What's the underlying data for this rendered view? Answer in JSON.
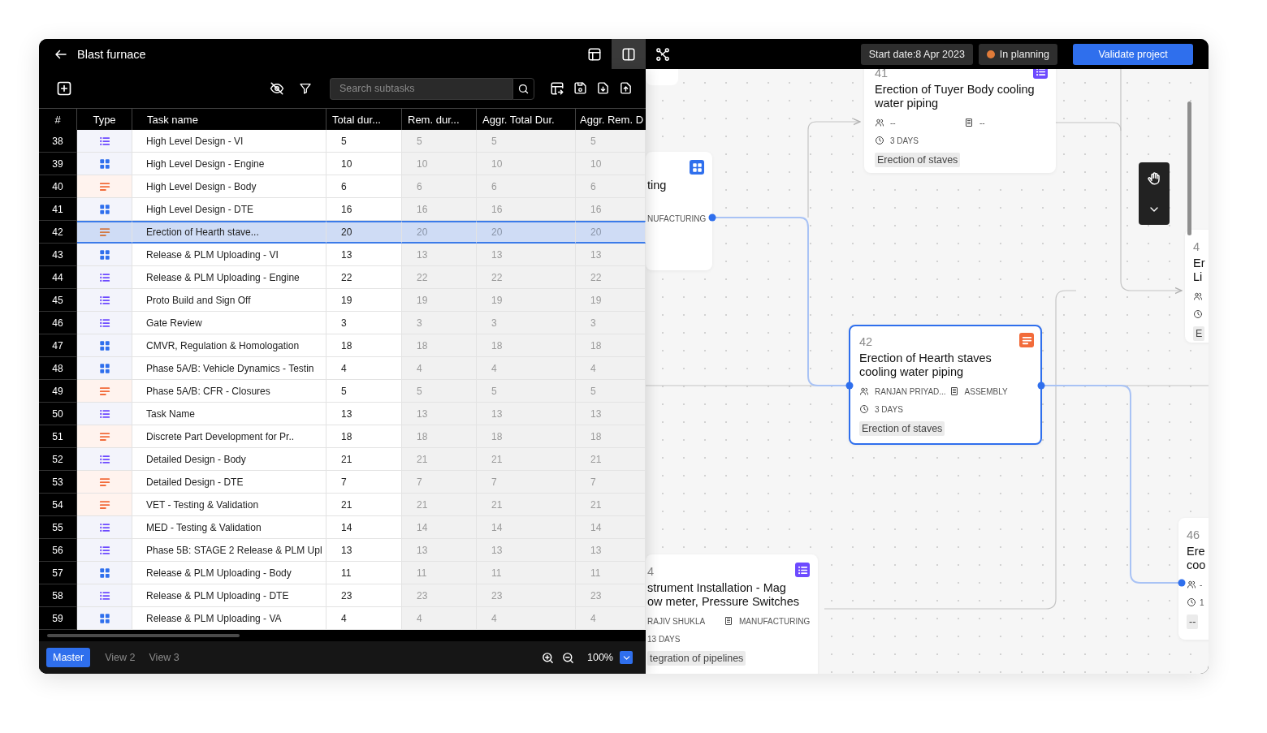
{
  "window": {
    "title": "Blast furnace"
  },
  "view_modes": [
    {
      "kind": "table",
      "selected": false
    },
    {
      "kind": "split",
      "selected": true
    },
    {
      "kind": "graph",
      "selected": false
    }
  ],
  "start_date": "Start date:8 Apr 2023",
  "status": {
    "label": "In planning",
    "color": "#e07b39"
  },
  "validate_button": "Validate project",
  "toolbar": {
    "search": {
      "placeholder": "Search subtasks"
    }
  },
  "table": {
    "columns": [
      "#",
      "Type",
      "Task name",
      "Total dur...",
      "Rem. dur...",
      "Aggr. Total Dur.",
      "Aggr. Rem. D"
    ],
    "rows": [
      {
        "number": "38",
        "kind": "list",
        "name": "High Level Design - VI",
        "total": "5",
        "rem": "5",
        "aggr_total": "5",
        "aggr_rem": "5",
        "selected": false
      },
      {
        "number": "39",
        "kind": "grid",
        "name": "High Level Design - Engine",
        "total": "10",
        "rem": "10",
        "aggr_total": "10",
        "aggr_rem": "10",
        "selected": false
      },
      {
        "number": "40",
        "kind": "lines",
        "name": "High Level Design - Body",
        "total": "6",
        "rem": "6",
        "aggr_total": "6",
        "aggr_rem": "6",
        "selected": false
      },
      {
        "number": "41",
        "kind": "grid",
        "name": "High Level Design - DTE",
        "total": "16",
        "rem": "16",
        "aggr_total": "16",
        "aggr_rem": "16",
        "selected": false
      },
      {
        "number": "42",
        "kind": "lines",
        "name": "Erection of Hearth stave...",
        "total": "20",
        "rem": "20",
        "aggr_total": "20",
        "aggr_rem": "20",
        "selected": true
      },
      {
        "number": "43",
        "kind": "grid",
        "name": "Release & PLM Uploading - VI",
        "total": "13",
        "rem": "13",
        "aggr_total": "13",
        "aggr_rem": "13",
        "selected": false
      },
      {
        "number": "44",
        "kind": "list",
        "name": "Release & PLM Uploading - Engine",
        "total": "22",
        "rem": "22",
        "aggr_total": "22",
        "aggr_rem": "22",
        "selected": false
      },
      {
        "number": "45",
        "kind": "list",
        "name": "Proto Build and Sign Off",
        "total": "19",
        "rem": "19",
        "aggr_total": "19",
        "aggr_rem": "19",
        "selected": false
      },
      {
        "number": "46",
        "kind": "list",
        "name": "Gate Review",
        "total": "3",
        "rem": "3",
        "aggr_total": "3",
        "aggr_rem": "3",
        "selected": false
      },
      {
        "number": "47",
        "kind": "grid",
        "name": "CMVR, Regulation & Homologation",
        "total": "18",
        "rem": "18",
        "aggr_total": "18",
        "aggr_rem": "18",
        "selected": false
      },
      {
        "number": "48",
        "kind": "grid",
        "name": "Phase 5A/B: Vehicle Dynamics - Testin",
        "total": "4",
        "rem": "4",
        "aggr_total": "4",
        "aggr_rem": "4",
        "selected": false
      },
      {
        "number": "49",
        "kind": "lines",
        "name": "Phase 5A/B: CFR - Closures",
        "total": "5",
        "rem": "5",
        "aggr_total": "5",
        "aggr_rem": "5",
        "selected": false
      },
      {
        "number": "50",
        "kind": "list",
        "name": "Task Name",
        "total": "13",
        "rem": "13",
        "aggr_total": "13",
        "aggr_rem": "13",
        "selected": false
      },
      {
        "number": "51",
        "kind": "lines",
        "name": "Discrete Part Development for Pr..",
        "total": "18",
        "rem": "18",
        "aggr_total": "18",
        "aggr_rem": "18",
        "selected": false
      },
      {
        "number": "52",
        "kind": "list",
        "name": "Detailed Design - Body",
        "total": "21",
        "rem": "21",
        "aggr_total": "21",
        "aggr_rem": "21",
        "selected": false
      },
      {
        "number": "53",
        "kind": "lines",
        "name": "Detailed Design - DTE",
        "total": "7",
        "rem": "7",
        "aggr_total": "7",
        "aggr_rem": "7",
        "selected": false
      },
      {
        "number": "54",
        "kind": "lines",
        "name": "VET - Testing & Validation",
        "total": "21",
        "rem": "21",
        "aggr_total": "21",
        "aggr_rem": "21",
        "selected": false
      },
      {
        "number": "55",
        "kind": "list",
        "name": "MED - Testing & Validation",
        "total": "14",
        "rem": "14",
        "aggr_total": "14",
        "aggr_rem": "14",
        "selected": false
      },
      {
        "number": "56",
        "kind": "list",
        "name": "Phase 5B: STAGE 2 Release & PLM Upl",
        "total": "13",
        "rem": "13",
        "aggr_total": "13",
        "aggr_rem": "13",
        "selected": false
      },
      {
        "number": "57",
        "kind": "grid",
        "name": "Release & PLM Uploading - Body",
        "total": "11",
        "rem": "11",
        "aggr_total": "11",
        "aggr_rem": "11",
        "selected": false
      },
      {
        "number": "58",
        "kind": "list",
        "name": "Release & PLM Uploading - DTE",
        "total": "23",
        "rem": "23",
        "aggr_total": "23",
        "aggr_rem": "23",
        "selected": false
      },
      {
        "number": "59",
        "kind": "grid",
        "name": "Release & PLM Uploading - VA",
        "total": "4",
        "rem": "4",
        "aggr_total": "4",
        "aggr_rem": "4",
        "selected": false
      }
    ]
  },
  "views": [
    {
      "label": "Master",
      "selected": true
    },
    {
      "label": "View 2",
      "selected": false
    },
    {
      "label": "View 3",
      "selected": false
    }
  ],
  "zoom": "100%",
  "canvas": {
    "cards": [
      {
        "title_lines": [
          "ting"
        ],
        "department": "NUFACTURING",
        "kind": "grid",
        "selected": false
      },
      {
        "number": "41",
        "title_lines": [
          "Erection of Tuyer Body cooling",
          "water piping"
        ],
        "assignee": "--",
        "department": "--",
        "duration": "3 DAYS",
        "tag": "Erection of staves",
        "kind": "list",
        "selected": false
      },
      {
        "number": "42",
        "title_lines": [
          "Erection of Hearth staves",
          "cooling water piping"
        ],
        "assignee": "RANJAN PRIYAD...",
        "department": "ASSEMBLY",
        "duration": "3 DAYS",
        "tag": "Erection of staves",
        "kind": "lines",
        "selected": true
      },
      {
        "number": "4",
        "title_lines": [
          "Er",
          "Li"
        ],
        "tag": "E",
        "selected": false
      },
      {
        "number": "4",
        "title_lines": [
          "strument Installation - Mag",
          "ow meter, Pressure Switches"
        ],
        "assignee": "RAJIV SHUKLA",
        "department": "MANUFACTURING",
        "duration": "13 DAYS",
        "tag": "tegration of pipelines",
        "kind": "list",
        "selected": false
      },
      {
        "number": "46",
        "title_lines": [
          "Ere",
          "coo"
        ],
        "assignee": "-",
        "duration": "1",
        "tag": "--",
        "selected": false
      }
    ]
  }
}
